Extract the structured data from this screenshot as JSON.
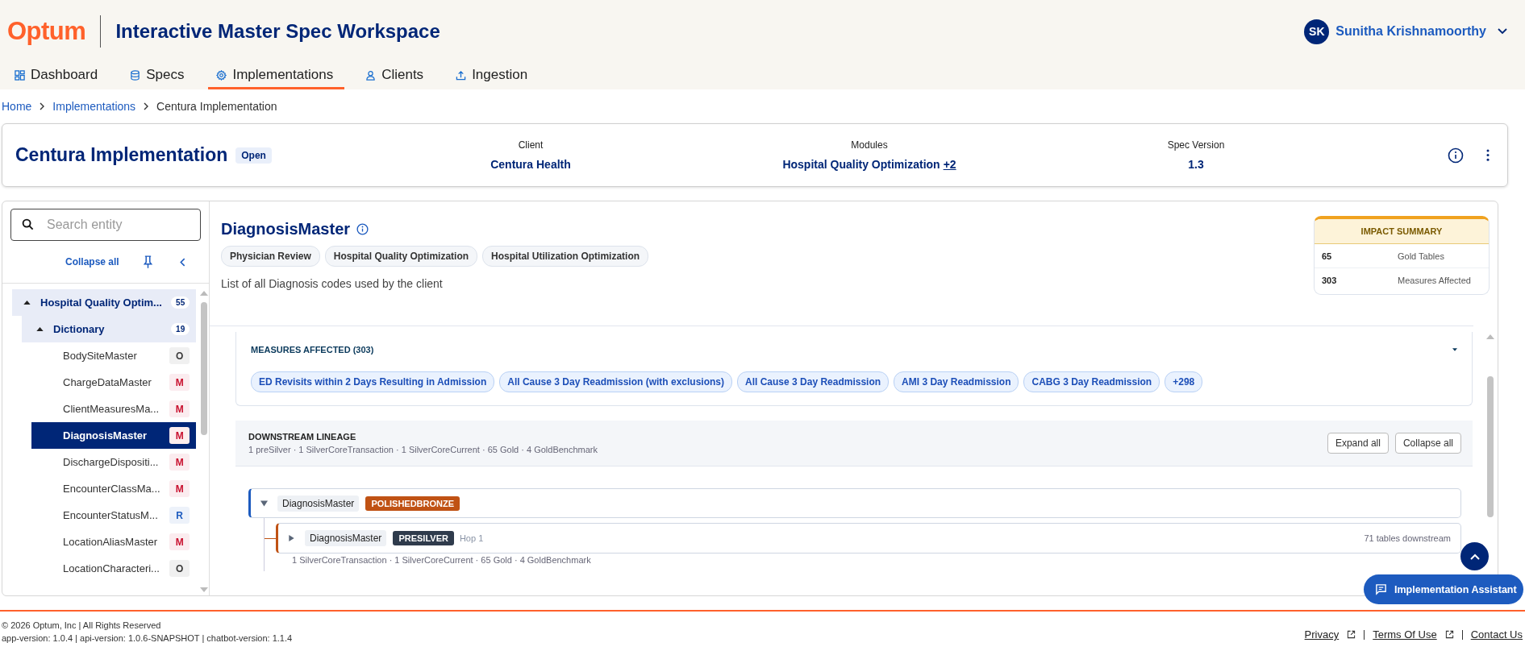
{
  "header": {
    "logo": "Optum",
    "app_title": "Interactive Master Spec Workspace",
    "user": {
      "initials": "SK",
      "name": "Sunitha Krishnamoorthy"
    }
  },
  "nav": [
    {
      "label": "Dashboard",
      "selected": false
    },
    {
      "label": "Specs",
      "selected": false
    },
    {
      "label": "Implementations",
      "selected": true
    },
    {
      "label": "Clients",
      "selected": false
    },
    {
      "label": "Ingestion",
      "selected": false
    }
  ],
  "breadcrumb": [
    {
      "label": "Home",
      "kind": "link"
    },
    {
      "label": "Implementations",
      "kind": "link"
    },
    {
      "label": "Centura Implementation",
      "kind": "current"
    }
  ],
  "implementation": {
    "title": "Centura Implementation",
    "status": "Open",
    "fields": [
      {
        "label": "Client",
        "value": "Centura Health"
      },
      {
        "label": "Modules",
        "value": "Hospital Quality Optimization",
        "extra": "+2"
      },
      {
        "label": "Spec Version",
        "value": "1.3"
      }
    ]
  },
  "sidebar": {
    "search": {
      "placeholder": "Search entity"
    },
    "collapse_all": "Collapse all",
    "tree": [
      {
        "label": "Hospital Quality Optim...",
        "count": "55",
        "expanded": true,
        "children": [
          {
            "label": "Dictionary",
            "count": "19",
            "expanded": true,
            "children": [
              {
                "label": "BodySiteMaster",
                "badge": "O",
                "color": "#3a3a3a",
                "selected": false
              },
              {
                "label": "ChargeDataMaster",
                "badge": "M",
                "color": "#c8102e",
                "selected": false
              },
              {
                "label": "ClientMeasuresMa...",
                "badge": "M",
                "color": "#c8102e",
                "selected": false
              },
              {
                "label": "DiagnosisMaster",
                "badge": "M",
                "color": "#c8102e",
                "selected": true
              },
              {
                "label": "DischargeDispositi...",
                "badge": "M",
                "color": "#c8102e",
                "selected": false
              },
              {
                "label": "EncounterClassMa...",
                "badge": "M",
                "color": "#c8102e",
                "selected": false
              },
              {
                "label": "EncounterStatusM...",
                "badge": "R",
                "color": "#1d5bbf",
                "selected": false
              },
              {
                "label": "LocationAliasMaster",
                "badge": "M",
                "color": "#c8102e",
                "selected": false
              },
              {
                "label": "LocationCharacteri...",
                "badge": "O",
                "color": "#3a3a3a",
                "selected": false
              }
            ]
          }
        ]
      }
    ]
  },
  "entity": {
    "title": "DiagnosisMaster",
    "tags": [
      "Physician Review",
      "Hospital Quality Optimization",
      "Hospital Utilization Optimization"
    ],
    "description": "List of all Diagnosis codes used by the client"
  },
  "impact_summary": {
    "title": "IMPACT SUMMARY",
    "rows": [
      {
        "value": "65",
        "label": "Gold Tables"
      },
      {
        "value": "303",
        "label": "Measures Affected"
      }
    ]
  },
  "measures": {
    "title": "MEASURES AFFECTED (303)",
    "expanded": true,
    "chips": [
      "ED Revisits within 2 Days Resulting in Admission",
      "All Cause 3 Day Readmission (with exclusions)",
      "All Cause 3 Day Readmission",
      "AMI 3 Day Readmission",
      "CABG 3 Day Readmission",
      "+298"
    ]
  },
  "lineage": {
    "title": "DOWNSTREAM LINEAGE",
    "summary": "1 preSilver · 1 SilverCoreTransaction · 1 SilverCoreCurrent · 65 Gold · 4 GoldBenchmark",
    "buttons": [
      "Expand all",
      "Collapse all"
    ],
    "nodes": [
      {
        "name": "DiagnosisMaster",
        "layer": "POLISHEDBRONZE",
        "color": "#c05214",
        "expanded": true,
        "children": [
          {
            "name": "DiagnosisMaster",
            "layer": "PRESILVER",
            "color": "#2f3b4c",
            "expanded": false,
            "hop": "Hop 1",
            "downstream": "71 tables downstream",
            "summary": "1 SilverCoreTransaction · 1 SilverCoreCurrent · 65 Gold · 4 GoldBenchmark"
          }
        ]
      }
    ]
  },
  "assistant": {
    "label": "Implementation Assistant"
  },
  "footer": {
    "copyright": "© 2026 Optum, Inc | All Rights Reserved",
    "versions": "app-version: 1.0.4 | api-version: 1.0.6-SNAPSHOT | chatbot-version: 1.1.4",
    "links": [
      {
        "label": "Privacy",
        "external": true
      },
      {
        "label": "Terms Of Use",
        "external": true
      },
      {
        "label": "Contact Us",
        "external": false
      }
    ]
  }
}
